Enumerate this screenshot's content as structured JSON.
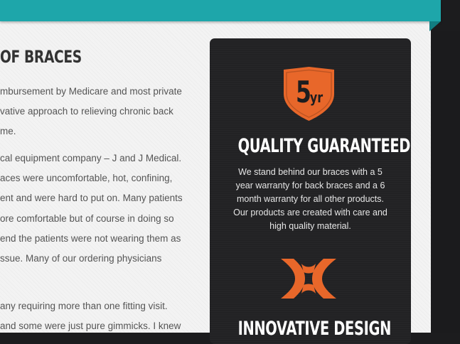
{
  "section": {
    "heading": "OF BRACES",
    "lines": [
      "mbursement by Medicare and most private",
      "vative approach to relieving chronic back",
      "me.",
      "cal equipment company – J and J Medical.",
      "aces were uncomfortable, hot, confining,",
      "ent and were hard to put on. Many patients",
      "ore comfortable but of course in doing so",
      "end the patients were not wearing them as",
      "ssue. Many of our ordering physicians",
      "any requiring more than one fitting visit.",
      "and some were just pure gimmicks. I knew"
    ]
  },
  "sidebar": {
    "quality": {
      "icon": "shield-5yr-icon",
      "badge_number": "5",
      "badge_unit": "yr",
      "title": "QUALITY GUARANTEED",
      "lines": [
        "We stand behind our braces with a 5",
        "year warranty for back braces and a 6",
        "month warranty for all other products.",
        "Our products are created with care and",
        "high quality material."
      ]
    },
    "innovative": {
      "icon": "innovation-x-icon",
      "title": "INNOVATIVE DESIGN"
    }
  },
  "colors": {
    "banner": "#1ea6aa",
    "accent": "#e8672a",
    "sidebar_bg": "#222224",
    "page_bg": "#f3f3f3"
  }
}
